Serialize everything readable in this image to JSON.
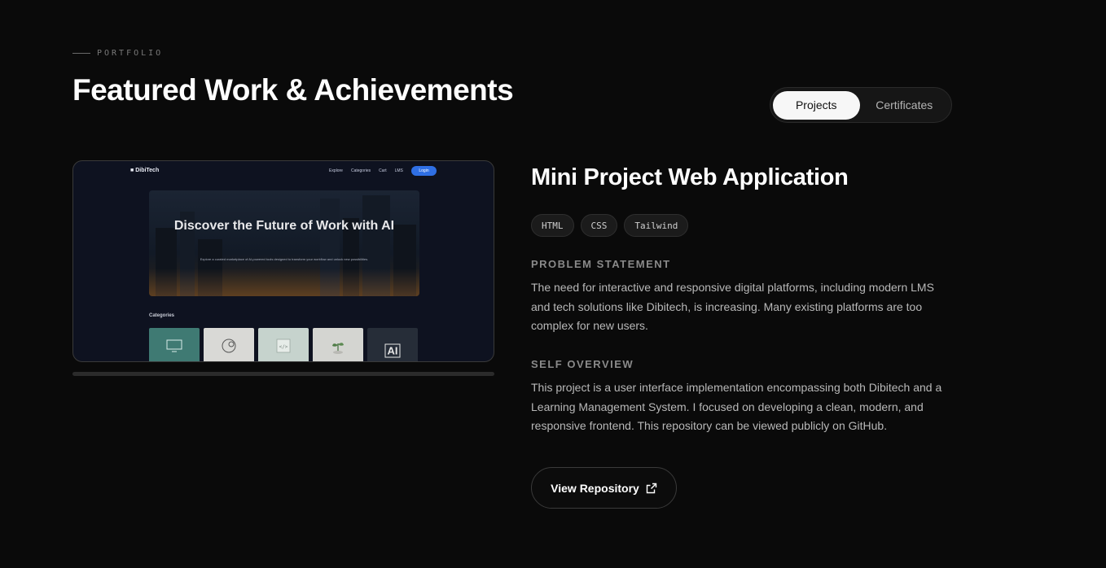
{
  "section": {
    "eyebrow": "PORTFOLIO",
    "title": "Featured Work & Achievements"
  },
  "toggle": {
    "options": [
      "Projects",
      "Certificates"
    ],
    "active": "Projects"
  },
  "preview": {
    "site_logo": "DibiTech",
    "nav_links": [
      "Explore",
      "Categories",
      "Cart",
      "LMS"
    ],
    "login_label": "Login",
    "hero_title": "Discover the Future of Work with AI",
    "hero_subtitle": "Explore a curated marketplace of AI-powered tools designed to transform your workflow and unlock new possibilities.",
    "categories_label": "Categories",
    "tile_badge": "AI"
  },
  "project": {
    "title": "Mini Project Web Application",
    "tags": [
      "HTML",
      "CSS",
      "Tailwind"
    ],
    "problem_label": "PROBLEM STATEMENT",
    "problem_text": "The need for interactive and responsive digital platforms, including modern LMS and tech solutions like Dibitech, is increasing. Many existing platforms are too complex for new users.",
    "overview_label": "SELF OVERVIEW",
    "overview_text": "This project is a user interface implementation encompassing both Dibitech and a Learning Management System. I focused on developing a clean, modern, and responsive frontend. This repository can be viewed publicly on GitHub.",
    "repo_button": "View Repository"
  },
  "colors": {
    "background": "#0a0a0a",
    "accent_blue": "#2f6fe4"
  }
}
